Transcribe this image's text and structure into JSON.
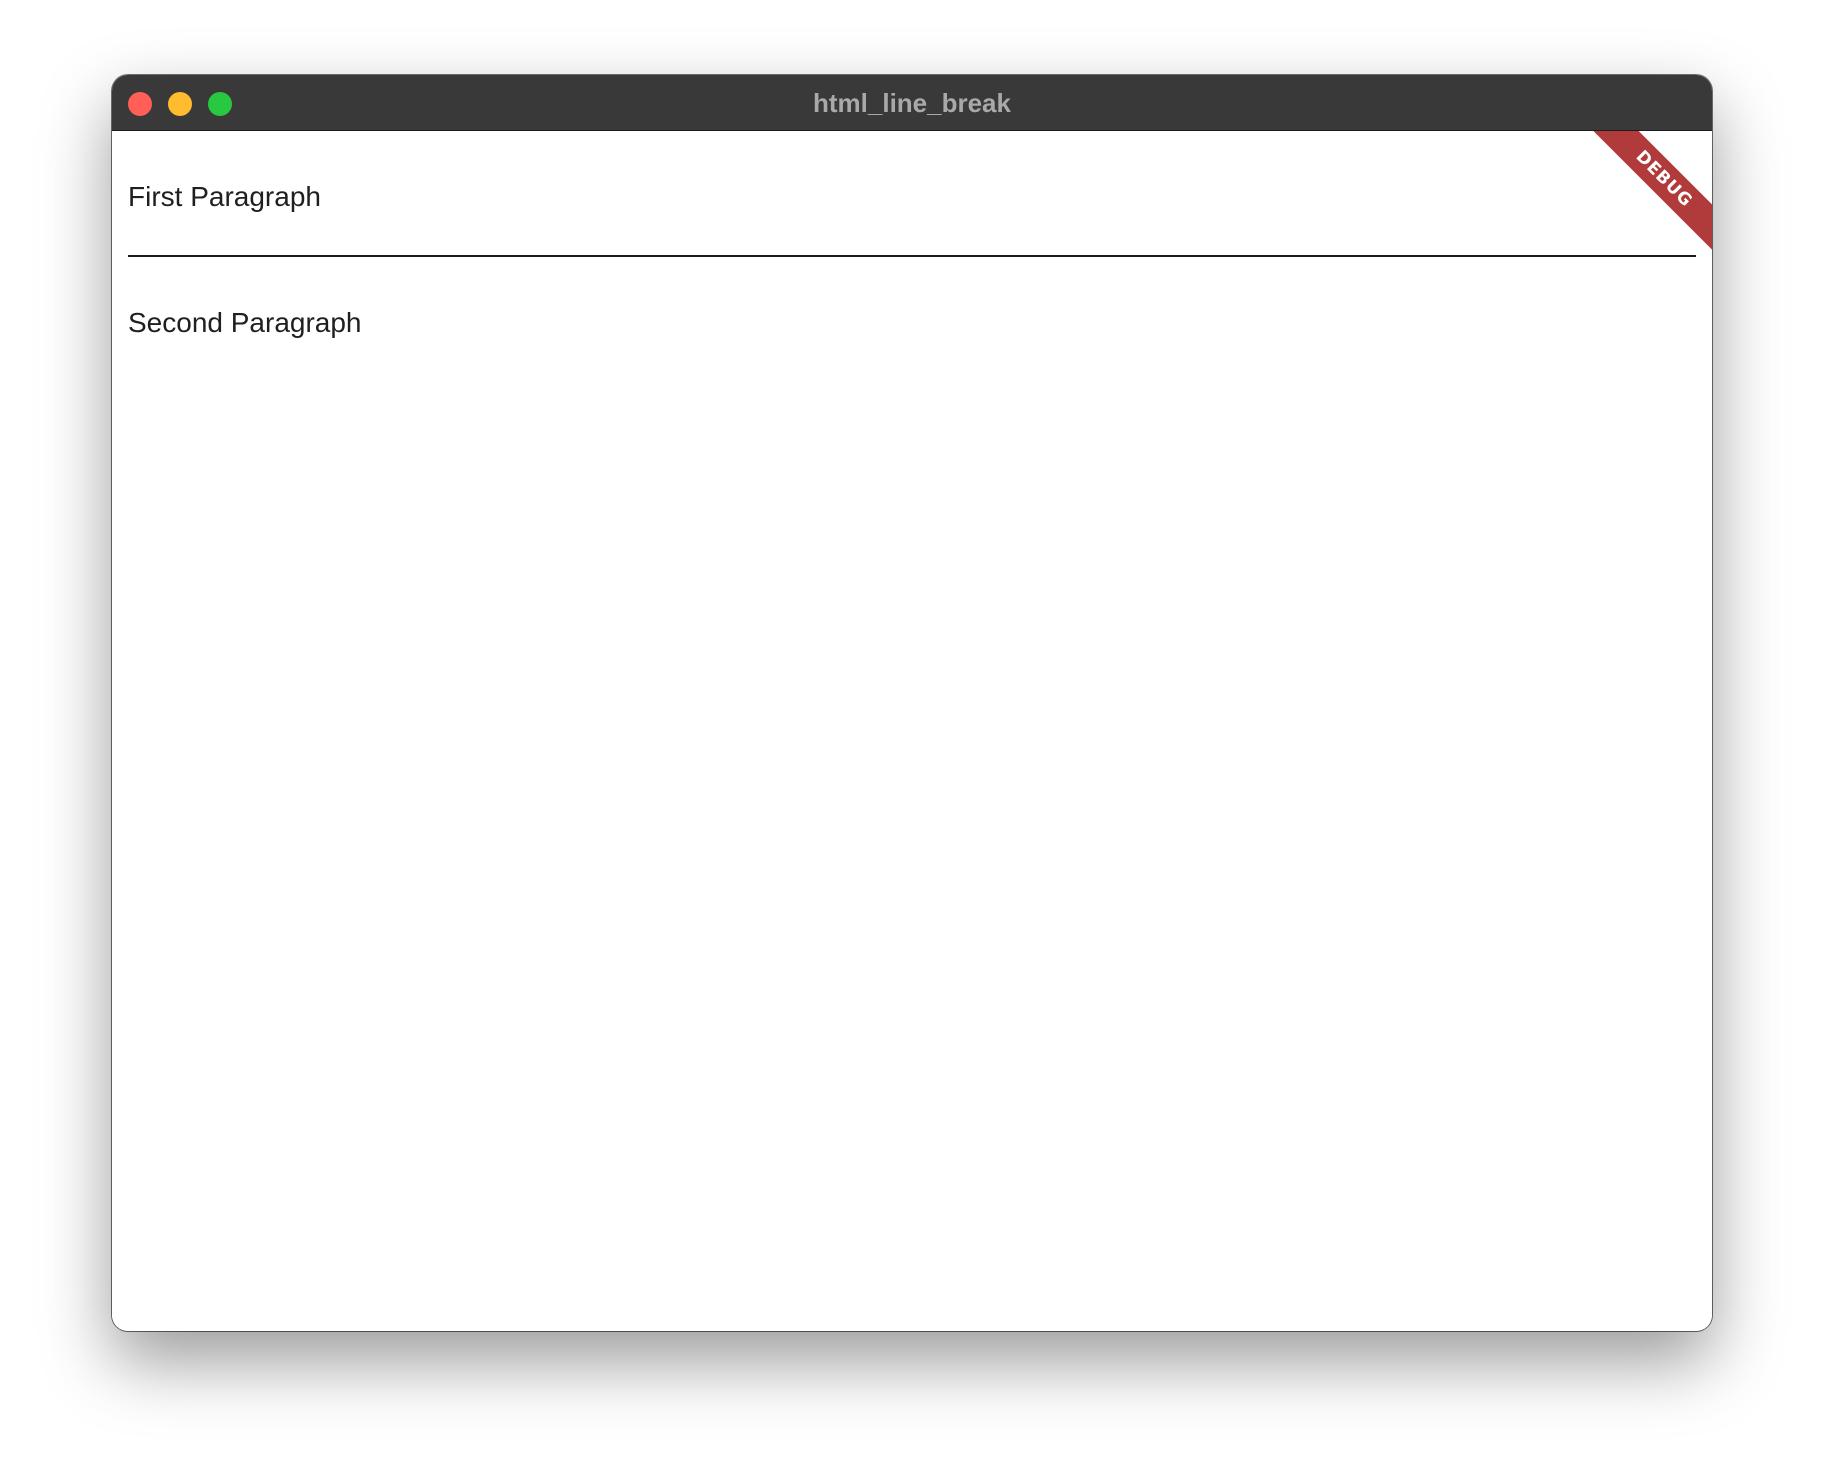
{
  "window": {
    "title": "html_line_break",
    "controls": {
      "close_color": "#ff5f57",
      "minimize_color": "#febc2e",
      "zoom_color": "#28c840"
    }
  },
  "content": {
    "first_paragraph": "First Paragraph",
    "second_paragraph": "Second Paragraph"
  },
  "debug_banner": {
    "label": "DEBUG",
    "color": "#b13b3b"
  }
}
